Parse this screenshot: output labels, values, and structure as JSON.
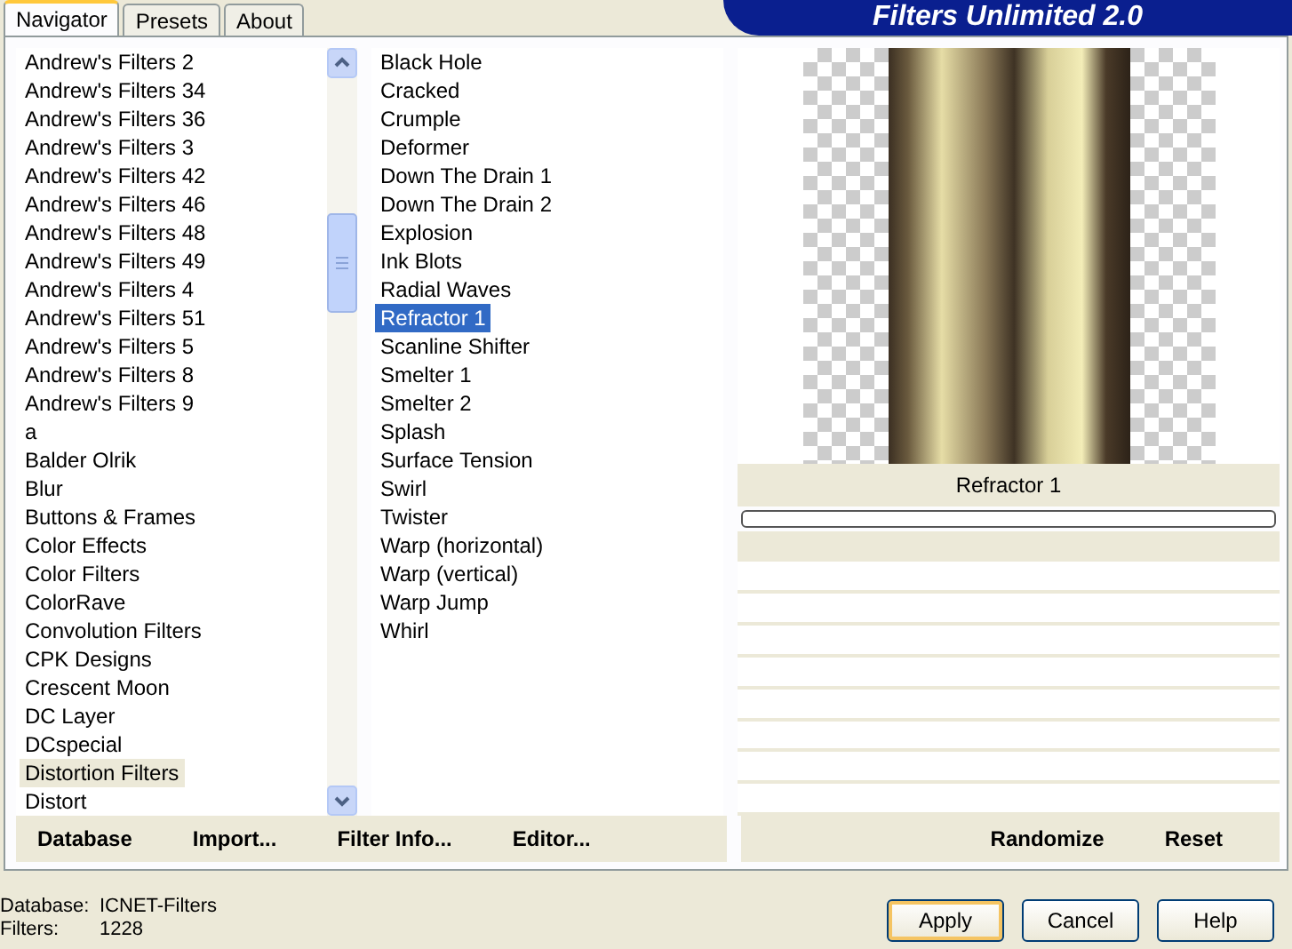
{
  "tabs": [
    {
      "label": "Navigator",
      "selected": true
    },
    {
      "label": "Presets",
      "selected": false
    },
    {
      "label": "About",
      "selected": false
    }
  ],
  "banner": {
    "title": "Filters Unlimited 2.0"
  },
  "categories": [
    {
      "label": "Andrew's Filters 2",
      "selected": false
    },
    {
      "label": "Andrew's Filters 34",
      "selected": false
    },
    {
      "label": "Andrew's Filters 36",
      "selected": false
    },
    {
      "label": "Andrew's Filters 3",
      "selected": false
    },
    {
      "label": "Andrew's Filters 42",
      "selected": false
    },
    {
      "label": "Andrew's Filters 46",
      "selected": false
    },
    {
      "label": "Andrew's Filters 48",
      "selected": false
    },
    {
      "label": "Andrew's Filters 49",
      "selected": false
    },
    {
      "label": "Andrew's Filters 4",
      "selected": false
    },
    {
      "label": "Andrew's Filters 51",
      "selected": false
    },
    {
      "label": "Andrew's Filters 5",
      "selected": false
    },
    {
      "label": "Andrew's Filters 8",
      "selected": false
    },
    {
      "label": "Andrew's Filters 9",
      "selected": false
    },
    {
      "label": "a",
      "selected": false
    },
    {
      "label": "Balder Olrik",
      "selected": false
    },
    {
      "label": "Blur",
      "selected": false
    },
    {
      "label": "Buttons & Frames",
      "selected": false
    },
    {
      "label": "Color Effects",
      "selected": false
    },
    {
      "label": "Color Filters",
      "selected": false
    },
    {
      "label": "ColorRave",
      "selected": false
    },
    {
      "label": "Convolution Filters",
      "selected": false
    },
    {
      "label": "CPK Designs",
      "selected": false
    },
    {
      "label": "Crescent Moon",
      "selected": false
    },
    {
      "label": "DC Layer",
      "selected": false
    },
    {
      "label": "DCspecial",
      "selected": false
    },
    {
      "label": "Distortion Filters",
      "selected": true
    },
    {
      "label": "Distort",
      "selected": false
    }
  ],
  "filters": [
    {
      "label": "Black Hole",
      "selected": false
    },
    {
      "label": "Cracked",
      "selected": false
    },
    {
      "label": "Crumple",
      "selected": false
    },
    {
      "label": "Deformer",
      "selected": false
    },
    {
      "label": "Down The Drain 1",
      "selected": false
    },
    {
      "label": "Down The Drain 2",
      "selected": false
    },
    {
      "label": "Explosion",
      "selected": false
    },
    {
      "label": "Ink Blots",
      "selected": false
    },
    {
      "label": "Radial Waves",
      "selected": false
    },
    {
      "label": "Refractor 1",
      "selected": true
    },
    {
      "label": "Scanline Shifter",
      "selected": false
    },
    {
      "label": "Smelter 1",
      "selected": false
    },
    {
      "label": "Smelter 2",
      "selected": false
    },
    {
      "label": "Splash",
      "selected": false
    },
    {
      "label": "Surface Tension",
      "selected": false
    },
    {
      "label": "Swirl",
      "selected": false
    },
    {
      "label": "Twister",
      "selected": false
    },
    {
      "label": "Warp (horizontal)",
      "selected": false
    },
    {
      "label": "Warp (vertical)",
      "selected": false
    },
    {
      "label": "Warp Jump",
      "selected": false
    },
    {
      "label": "Whirl",
      "selected": false
    }
  ],
  "preview": {
    "filter_name": "Refractor 1",
    "progress": {
      "level": 0
    }
  },
  "left_buttons": [
    "Database",
    "Import...",
    "Filter Info...",
    "Editor..."
  ],
  "right_buttons": [
    "Randomize",
    "Reset"
  ],
  "status": [
    {
      "label": "Database:",
      "value": "ICNET-Filters"
    },
    {
      "label": "Filters:",
      "value": "1228"
    }
  ],
  "dialog_buttons": [
    {
      "label": "Apply",
      "default": true
    },
    {
      "label": "Cancel",
      "default": false
    },
    {
      "label": "Help",
      "default": false
    }
  ]
}
